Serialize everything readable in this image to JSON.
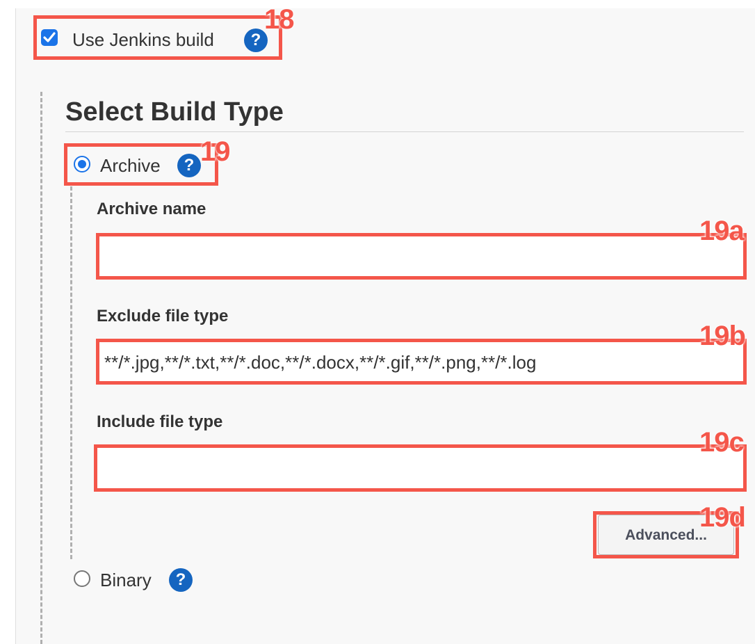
{
  "jenkins_build": {
    "label": "Use Jenkins build",
    "checked": true,
    "help_icon": "question-circle-icon",
    "help_glyph": "?"
  },
  "build_type": {
    "title": "Select Build Type",
    "options": [
      {
        "label": "Archive",
        "selected": true,
        "help_glyph": "?"
      },
      {
        "label": "Binary",
        "selected": false,
        "help_glyph": "?"
      }
    ]
  },
  "archive": {
    "archive_name": {
      "label": "Archive name",
      "value": ""
    },
    "exclude_file_type": {
      "label": "Exclude file type",
      "value": "**/*.jpg,**/*.txt,**/*.doc,**/*.docx,**/*.gif,**/*.png,**/*.log"
    },
    "include_file_type": {
      "label": "Include file type",
      "value": ""
    },
    "advanced_button": "Advanced..."
  },
  "annotations": [
    "18",
    "19",
    "19a",
    "19b",
    "19c",
    "19d"
  ],
  "colors": {
    "annotation": "#f4564a",
    "accent": "#1a73e8",
    "help_icon": "#1565c0",
    "panel_background": "#f8f8f8"
  }
}
